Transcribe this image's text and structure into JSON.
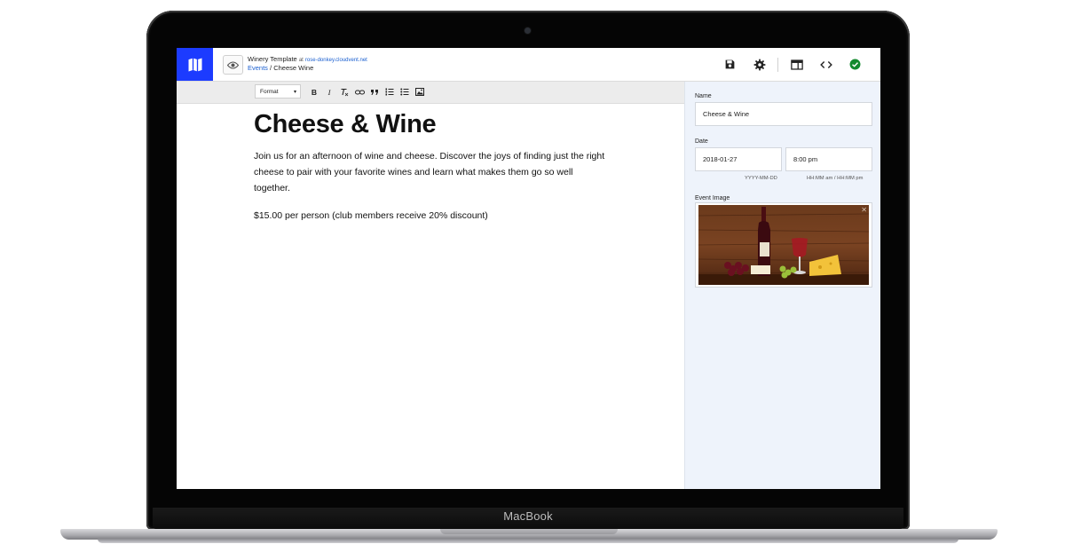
{
  "device": {
    "brand": "MacBook"
  },
  "header": {
    "site_name": "Winery Template",
    "at_text": "at",
    "site_domain": "rose-donkey.cloudvent.net",
    "breadcrumb": {
      "section": "Events",
      "separator": "/",
      "page": "Cheese Wine"
    },
    "icons": [
      "map-icon",
      "eye-icon",
      "save-icon",
      "gear-icon",
      "layout-icon",
      "code-icon",
      "check-circle-icon"
    ],
    "colors": {
      "logo_bg": "#1c3bff",
      "status_ok": "#138a2e",
      "link": "#1a5fd0"
    }
  },
  "toolbar": {
    "format_label": "Format",
    "buttons": [
      "bold",
      "italic",
      "clear-format",
      "link",
      "blockquote",
      "numbered-list",
      "bulleted-list",
      "image"
    ]
  },
  "document": {
    "title": "Cheese & Wine",
    "body": "Join us for an afternoon of wine and cheese. Discover the joys of finding just the right cheese to pair with your favorite wines and learn what makes them go so well together.",
    "price": "$15.00 per person (club members receive 20% discount)"
  },
  "panel": {
    "name_label": "Name",
    "name_value": "Cheese & Wine",
    "date_label": "Date",
    "date_value": "2018-01-27",
    "date_hint": "YYYY-MM-DD",
    "time_value": "8:00 pm",
    "time_hint": "HH:MM am / HH:MM pm",
    "image_label": "Event Image"
  }
}
